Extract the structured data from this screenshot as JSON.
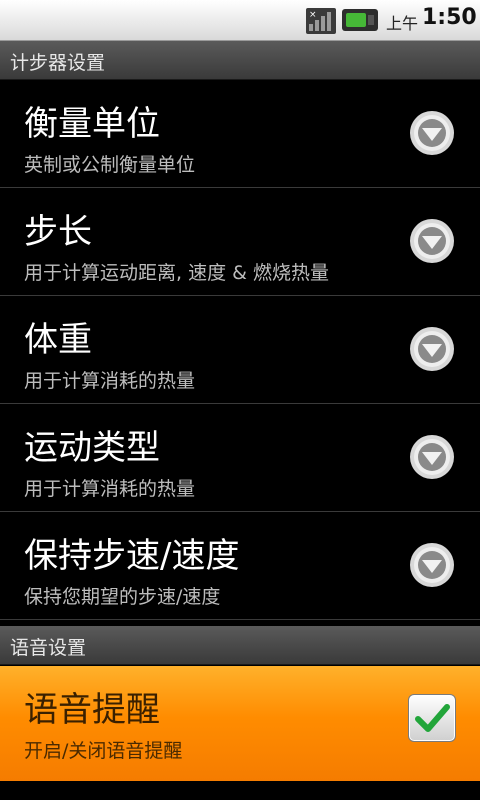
{
  "status_bar": {
    "ampm": "上午",
    "time": "1:50",
    "icons": [
      "signal-icon",
      "battery-icon"
    ]
  },
  "sections": [
    {
      "header": "计步器设置",
      "items": [
        {
          "title": "衡量单位",
          "summary": "英制或公制衡量单位",
          "widget": "dropdown-icon"
        },
        {
          "title": "步长",
          "summary": "用于计算运动距离, 速度 & 燃烧热量",
          "widget": "dropdown-icon"
        },
        {
          "title": "体重",
          "summary": "用于计算消耗的热量",
          "widget": "dropdown-icon"
        },
        {
          "title": "运动类型",
          "summary": "用于计算消耗的热量",
          "widget": "dropdown-icon"
        },
        {
          "title": "保持步速/速度",
          "summary": "保持您期望的步速/速度",
          "widget": "dropdown-icon"
        }
      ]
    },
    {
      "header": "语音设置",
      "items": [
        {
          "title": "语音提醒",
          "summary": "开启/关闭语音提醒",
          "widget": "checkbox",
          "checked": true
        }
      ]
    }
  ],
  "colors": {
    "highlight": "#ff8c00",
    "check": "#22a53a"
  }
}
